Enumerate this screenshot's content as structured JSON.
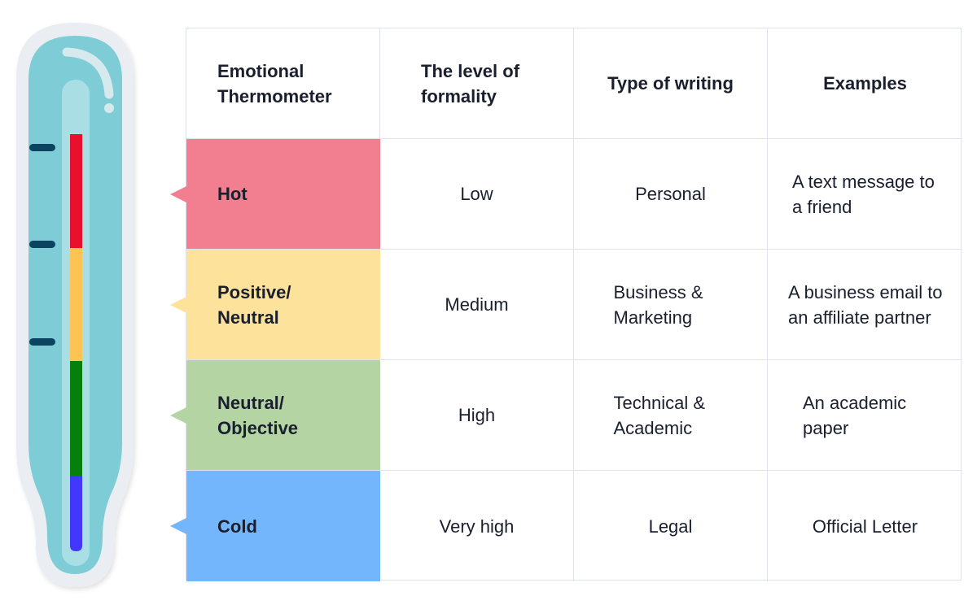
{
  "title": "Emotional Thermometer",
  "colors": {
    "hot": "#f27f8f",
    "positive_neutral": "#fde29b",
    "neutral_objective": "#b4d5a3",
    "cold": "#74b6fc",
    "thermo_red": "#e8102f",
    "thermo_yellow": "#fdc354",
    "thermo_green": "#077f0c",
    "thermo_blue": "#4237fc",
    "thermo_glass": "#7ecdd6",
    "thermo_tick": "#0b4460"
  },
  "headers": [
    "Emotional Thermometer",
    "The level of formality",
    "Type of writing",
    "Examples"
  ],
  "rows": [
    {
      "level": "Hot",
      "formality": "Low",
      "writing": "Personal",
      "example": "A text message to a friend"
    },
    {
      "level": "Positive/ Neutral",
      "formality": "Medium",
      "writing": "Business & Marketing",
      "example": "A business email to an affiliate partner"
    },
    {
      "level": "Neutral/ Objective",
      "formality": "High",
      "writing": "Technical & Academic",
      "example": "An academic paper"
    },
    {
      "level": "Cold",
      "formality": "Very high",
      "writing": "Legal",
      "example": "Official Letter"
    }
  ]
}
